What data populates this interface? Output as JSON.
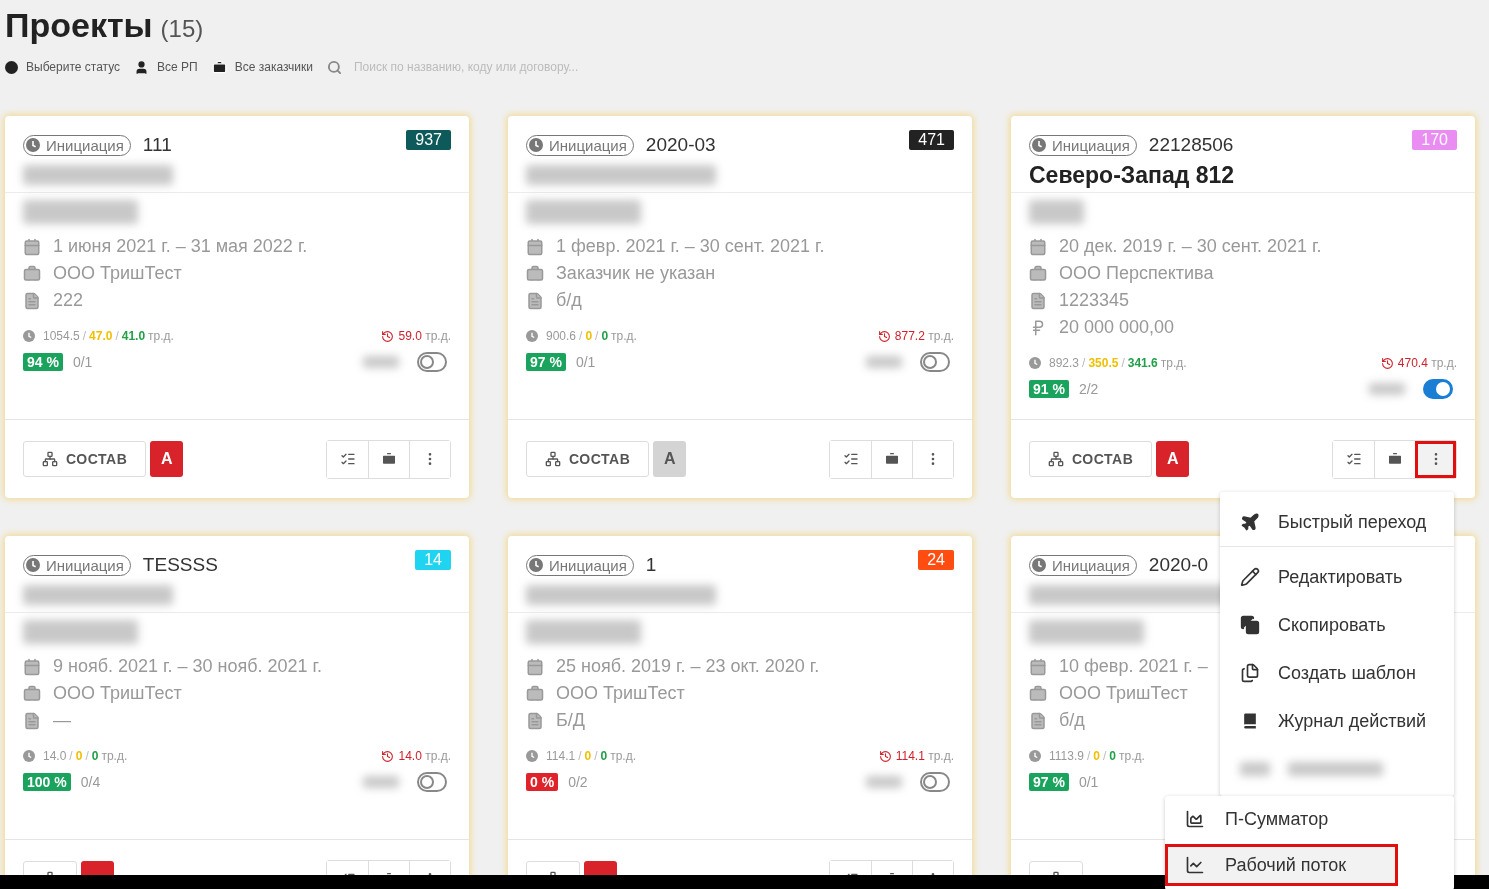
{
  "page": {
    "title": "Проекты",
    "count": "(15)"
  },
  "filters": [
    {
      "kind": "status",
      "label": "Выберите статус"
    },
    {
      "kind": "manager",
      "label": "Все РП"
    },
    {
      "kind": "customer",
      "label": "Все заказчики"
    }
  ],
  "search": {
    "placeholder": "Поиск по названию, коду или договору..."
  },
  "cards": [
    {
      "status": "Инициация",
      "code": "111",
      "badge": {
        "text": "937",
        "color": "#0e5a5a"
      },
      "info": [
        {
          "kind": "dates",
          "text": "1 июня 2021 г. – 31 мая 2022 г."
        },
        {
          "kind": "customer",
          "text": "ООО ТришТест"
        },
        {
          "kind": "contract",
          "text": "222"
        }
      ],
      "stats": [
        {
          "text": "1054.5",
          "color": "#9a9a9a"
        },
        {
          "text": "/",
          "color": "#bbbbbb"
        },
        {
          "text": "47.0",
          "color": "#f0c000"
        },
        {
          "text": "/",
          "color": "#bbbbbb"
        },
        {
          "text": "41.0",
          "color": "#21a048"
        },
        {
          "text": "тр.д.",
          "color": "#9a9a9a"
        }
      ],
      "overdue": {
        "value": "59.0",
        "unit": "тр.д."
      },
      "percent": {
        "text": "94 %",
        "color": "#1aa35c"
      },
      "tasks": "0/1",
      "toggle_on": false,
      "compose": "СОСТАВ",
      "a_label": "А",
      "a_active": true,
      "tools": [
        {
          "kind": "checklist"
        },
        {
          "kind": "briefcase"
        },
        {
          "kind": "more"
        }
      ],
      "menu_open": false
    },
    {
      "status": "Инициация",
      "code": "2020-03",
      "badge": {
        "text": "471",
        "color": "#222222"
      },
      "info": [
        {
          "kind": "dates",
          "text": "1 февр. 2021 г. – 30 сент. 2021 г."
        },
        {
          "kind": "customer",
          "text": "Заказчик не указан"
        },
        {
          "kind": "contract",
          "text": "б/д"
        }
      ],
      "stats": [
        {
          "text": "900.6",
          "color": "#9a9a9a"
        },
        {
          "text": "/",
          "color": "#bbbbbb"
        },
        {
          "text": "0",
          "color": "#f0c000"
        },
        {
          "text": "/",
          "color": "#bbbbbb"
        },
        {
          "text": "0",
          "color": "#21a048"
        },
        {
          "text": "тр.д.",
          "color": "#9a9a9a"
        }
      ],
      "overdue": {
        "value": "877.2",
        "unit": "тр.д."
      },
      "percent": {
        "text": "97 %",
        "color": "#1aa35c"
      },
      "tasks": "0/1",
      "toggle_on": false,
      "compose": "СОСТАВ",
      "a_label": "А",
      "a_active": false,
      "tools": [
        {
          "kind": "checklist"
        },
        {
          "kind": "briefcase"
        },
        {
          "kind": "more"
        }
      ],
      "menu_open": false
    },
    {
      "status": "Инициация",
      "code": "22128506",
      "badge": {
        "text": "170",
        "color": "#e98df2"
      },
      "title": "Северо-Запад 812",
      "info": [
        {
          "kind": "dates",
          "text": "20 дек. 2019 г. – 30 сент. 2021 г."
        },
        {
          "kind": "customer",
          "text": "ООО Перспектива"
        },
        {
          "kind": "contract",
          "text": "1223345"
        },
        {
          "kind": "amount",
          "text": "20 000 000,00"
        }
      ],
      "stats": [
        {
          "text": "892.3",
          "color": "#9a9a9a"
        },
        {
          "text": "/",
          "color": "#bbbbbb"
        },
        {
          "text": "350.5",
          "color": "#f0c000"
        },
        {
          "text": "/",
          "color": "#bbbbbb"
        },
        {
          "text": "341.6",
          "color": "#21a048"
        },
        {
          "text": "тр.д.",
          "color": "#9a9a9a"
        }
      ],
      "overdue": {
        "value": "470.4",
        "unit": "тр.д."
      },
      "percent": {
        "text": "91 %",
        "color": "#1aa35c"
      },
      "tasks": "2/2",
      "toggle_on": true,
      "compose": "СОСТАВ",
      "a_label": "А",
      "a_active": true,
      "tools": [
        {
          "kind": "checklist"
        },
        {
          "kind": "briefcase"
        },
        {
          "kind": "more"
        }
      ],
      "menu_open": true
    },
    {
      "status": "Инициация",
      "code": "TESSSS",
      "badge": {
        "text": "14",
        "color": "#1fd4f0"
      },
      "info": [
        {
          "kind": "dates",
          "text": "9 нояб. 2021 г. – 30 нояб. 2021 г."
        },
        {
          "kind": "customer",
          "text": "ООО ТришТест"
        },
        {
          "kind": "contract",
          "text": "—"
        }
      ],
      "stats": [
        {
          "text": "14.0",
          "color": "#9a9a9a"
        },
        {
          "text": "/",
          "color": "#bbbbbb"
        },
        {
          "text": "0",
          "color": "#f0c000"
        },
        {
          "text": "/",
          "color": "#bbbbbb"
        },
        {
          "text": "0",
          "color": "#21a048"
        },
        {
          "text": "тр.д.",
          "color": "#9a9a9a"
        }
      ],
      "overdue": {
        "value": "14.0",
        "unit": "тр.д."
      },
      "percent": {
        "text": "100 %",
        "color": "#1aa35c"
      },
      "tasks": "0/4",
      "toggle_on": false,
      "a_active": true,
      "tools": [
        {
          "kind": "checklist"
        },
        {
          "kind": "briefcase"
        },
        {
          "kind": "more"
        }
      ],
      "menu_open": false
    },
    {
      "status": "Инициация",
      "code": "1",
      "badge": {
        "text": "24",
        "color": "#ff4d12"
      },
      "info": [
        {
          "kind": "dates",
          "text": "25 нояб. 2019 г. – 23 окт. 2020 г."
        },
        {
          "kind": "customer",
          "text": "ООО ТришТест"
        },
        {
          "kind": "contract",
          "text": "Б/Д"
        }
      ],
      "stats": [
        {
          "text": "114.1",
          "color": "#9a9a9a"
        },
        {
          "text": "/",
          "color": "#bbbbbb"
        },
        {
          "text": "0",
          "color": "#f0c000"
        },
        {
          "text": "/",
          "color": "#bbbbbb"
        },
        {
          "text": "0",
          "color": "#21a048"
        },
        {
          "text": "тр.д.",
          "color": "#9a9a9a"
        }
      ],
      "overdue": {
        "value": "114.1",
        "unit": "тр.д."
      },
      "percent": {
        "text": "0 %",
        "color": "#e0232b"
      },
      "tasks": "0/2",
      "toggle_on": false,
      "a_active": true,
      "tools": [
        {
          "kind": "checklist"
        },
        {
          "kind": "briefcase"
        },
        {
          "kind": "more"
        }
      ],
      "menu_open": false
    },
    {
      "status": "Инициация",
      "code": "2020-0",
      "info": [
        {
          "kind": "dates",
          "text": "10 февр. 2021 г. –"
        },
        {
          "kind": "customer",
          "text": "ООО ТришТест"
        },
        {
          "kind": "contract",
          "text": "б/д"
        }
      ],
      "stats": [
        {
          "text": "1113.9",
          "color": "#9a9a9a"
        },
        {
          "text": "/",
          "color": "#bbbbbb"
        },
        {
          "text": "0",
          "color": "#f0c000"
        },
        {
          "text": "/",
          "color": "#bbbbbb"
        },
        {
          "text": "0",
          "color": "#21a048"
        },
        {
          "text": "тр.д.",
          "color": "#9a9a9a"
        }
      ],
      "percent": {
        "text": "97 %",
        "color": "#1aa35c"
      },
      "tasks": "0/1"
    }
  ],
  "menu": {
    "items": [
      {
        "kind": "jump",
        "label": "Быстрый переход"
      },
      {
        "kind": "edit",
        "label": "Редактировать"
      },
      {
        "kind": "copy",
        "label": "Скопировать"
      },
      {
        "kind": "template",
        "label": "Создать шаблон"
      },
      {
        "kind": "log",
        "label": "Журнал действий"
      },
      {
        "kind": "blurred"
      }
    ]
  },
  "submenu": {
    "items": [
      {
        "kind": "area",
        "label": "П-Сумматор",
        "highlighted": false
      },
      {
        "kind": "line",
        "label": "Рабочий поток",
        "highlighted": true
      }
    ]
  }
}
